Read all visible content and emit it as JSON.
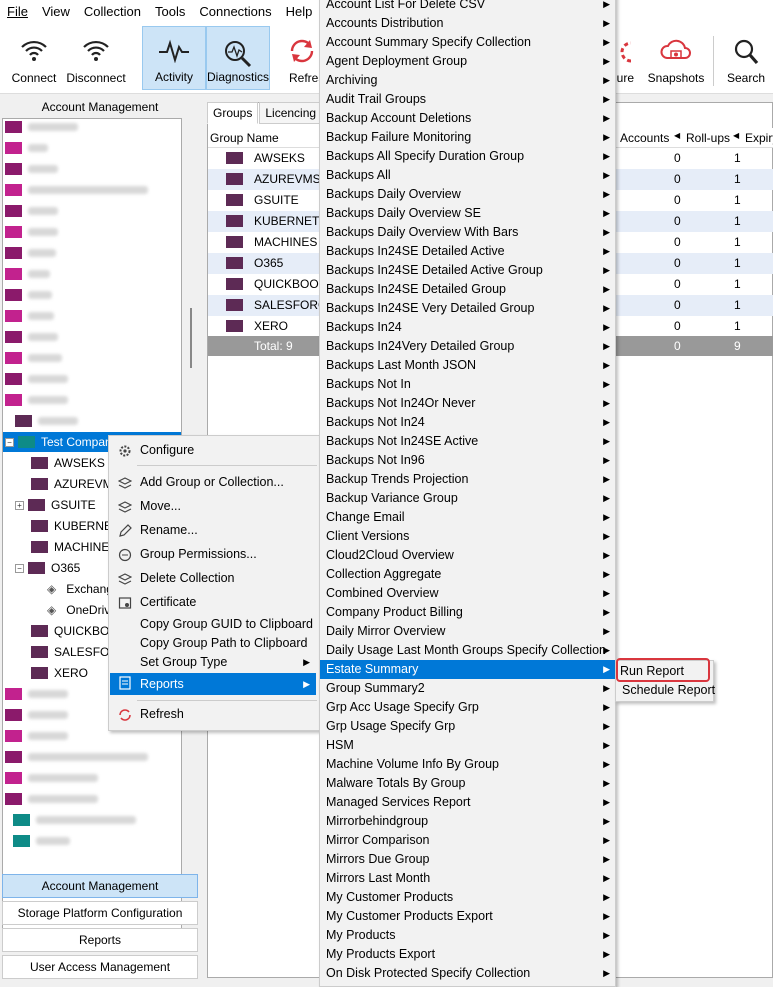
{
  "menubar": {
    "items": [
      "File",
      "View",
      "Collection",
      "Tools",
      "Connections",
      "Help"
    ]
  },
  "toolbar": {
    "connect": "Connect",
    "disconnect": "Disconnect",
    "activity": "Activity",
    "diagnostics": "Diagnostics",
    "refresh": "Refresh",
    "configure": "gure",
    "snapshots": "Snapshots",
    "search": "Search"
  },
  "left": {
    "title": "Account Management",
    "tree_selected": "Test Company",
    "children": [
      "AWSEKS",
      "AZUREVMS",
      "GSUITE",
      "KUBERNETES",
      "MACHINES",
      "O365",
      "QUICKBOOKS",
      "SALESFORCE",
      "XERO"
    ],
    "o365_children": [
      "Exchange",
      "OneDrive"
    ],
    "nav": [
      "Account Management",
      "Storage Platform Configuration",
      "Reports",
      "User Access Management"
    ]
  },
  "tabs": [
    "Groups",
    "Licencing"
  ],
  "grid": {
    "headers": [
      "Group Name",
      "Accounts",
      "Roll-ups",
      "Expiry"
    ],
    "rows": [
      {
        "name": "AWSEKS",
        "a": "0",
        "r": "1"
      },
      {
        "name": "AZUREVMS",
        "a": "0",
        "r": "1"
      },
      {
        "name": "GSUITE",
        "a": "0",
        "r": "1"
      },
      {
        "name": "KUBERNETES",
        "a": "0",
        "r": "1"
      },
      {
        "name": "MACHINES",
        "a": "0",
        "r": "1"
      },
      {
        "name": "O365",
        "a": "0",
        "r": "1"
      },
      {
        "name": "QUICKBOOKS",
        "a": "0",
        "r": "1"
      },
      {
        "name": "SALESFORCE",
        "a": "0",
        "r": "1"
      },
      {
        "name": "XERO",
        "a": "0",
        "r": "1"
      }
    ],
    "total_label": "Total: 9",
    "total_a": "0",
    "total_r": "9"
  },
  "context_menu": [
    "Configure",
    "Add Group or Collection...",
    "Move...",
    "Rename...",
    "Group Permissions...",
    "Delete Collection",
    "Certificate",
    "Copy Group GUID to Clipboard",
    "Copy Group Path to Clipboard",
    "Set Group Type",
    "Reports",
    "Refresh"
  ],
  "reports_menu": [
    "Account List For Delete CSV",
    "Accounts Distribution",
    "Account Summary Specify Collection",
    "Agent Deployment Group",
    "Archiving",
    "Audit Trail Groups",
    "Backup Account Deletions",
    "Backup Failure Monitoring",
    "Backups All Specify Duration Group",
    "Backups All",
    "Backups Daily Overview",
    "Backups Daily Overview SE",
    "Backups Daily Overview With Bars",
    "Backups In24SE Detailed Active",
    "Backups In24SE Detailed Active Group",
    "Backups In24SE Detailed Group",
    "Backups In24SE Very Detailed Group",
    "Backups In24",
    "Backups In24Very Detailed Group",
    "Backups Last Month JSON",
    "Backups Not In",
    "Backups Not In24Or Never",
    "Backups Not In24",
    "Backups Not In24SE Active",
    "Backups Not In96",
    "Backup Trends Projection",
    "Backup Variance Group",
    "Change Email",
    "Client Versions",
    "Cloud2Cloud Overview",
    "Collection Aggregate",
    "Combined Overview",
    "Company Product Billing",
    "Daily Mirror Overview",
    "Daily Usage Last Month Groups Specify Collection",
    "Estate Summary",
    "Group Summary2",
    "Grp Acc Usage Specify Grp",
    "Grp Usage Specify Grp",
    "HSM",
    "Machine Volume Info By Group",
    "Malware Totals By Group",
    "Managed Services Report",
    "Mirrorbehindgroup",
    "Mirror Comparison",
    "Mirrors Due Group",
    "Mirrors Last Month",
    "My Customer Products",
    "My Customer Products Export",
    "My Products",
    "My Products Export",
    "On Disk Protected Specify Collection"
  ],
  "estate_menu": [
    "Run Report",
    "Schedule Report"
  ]
}
